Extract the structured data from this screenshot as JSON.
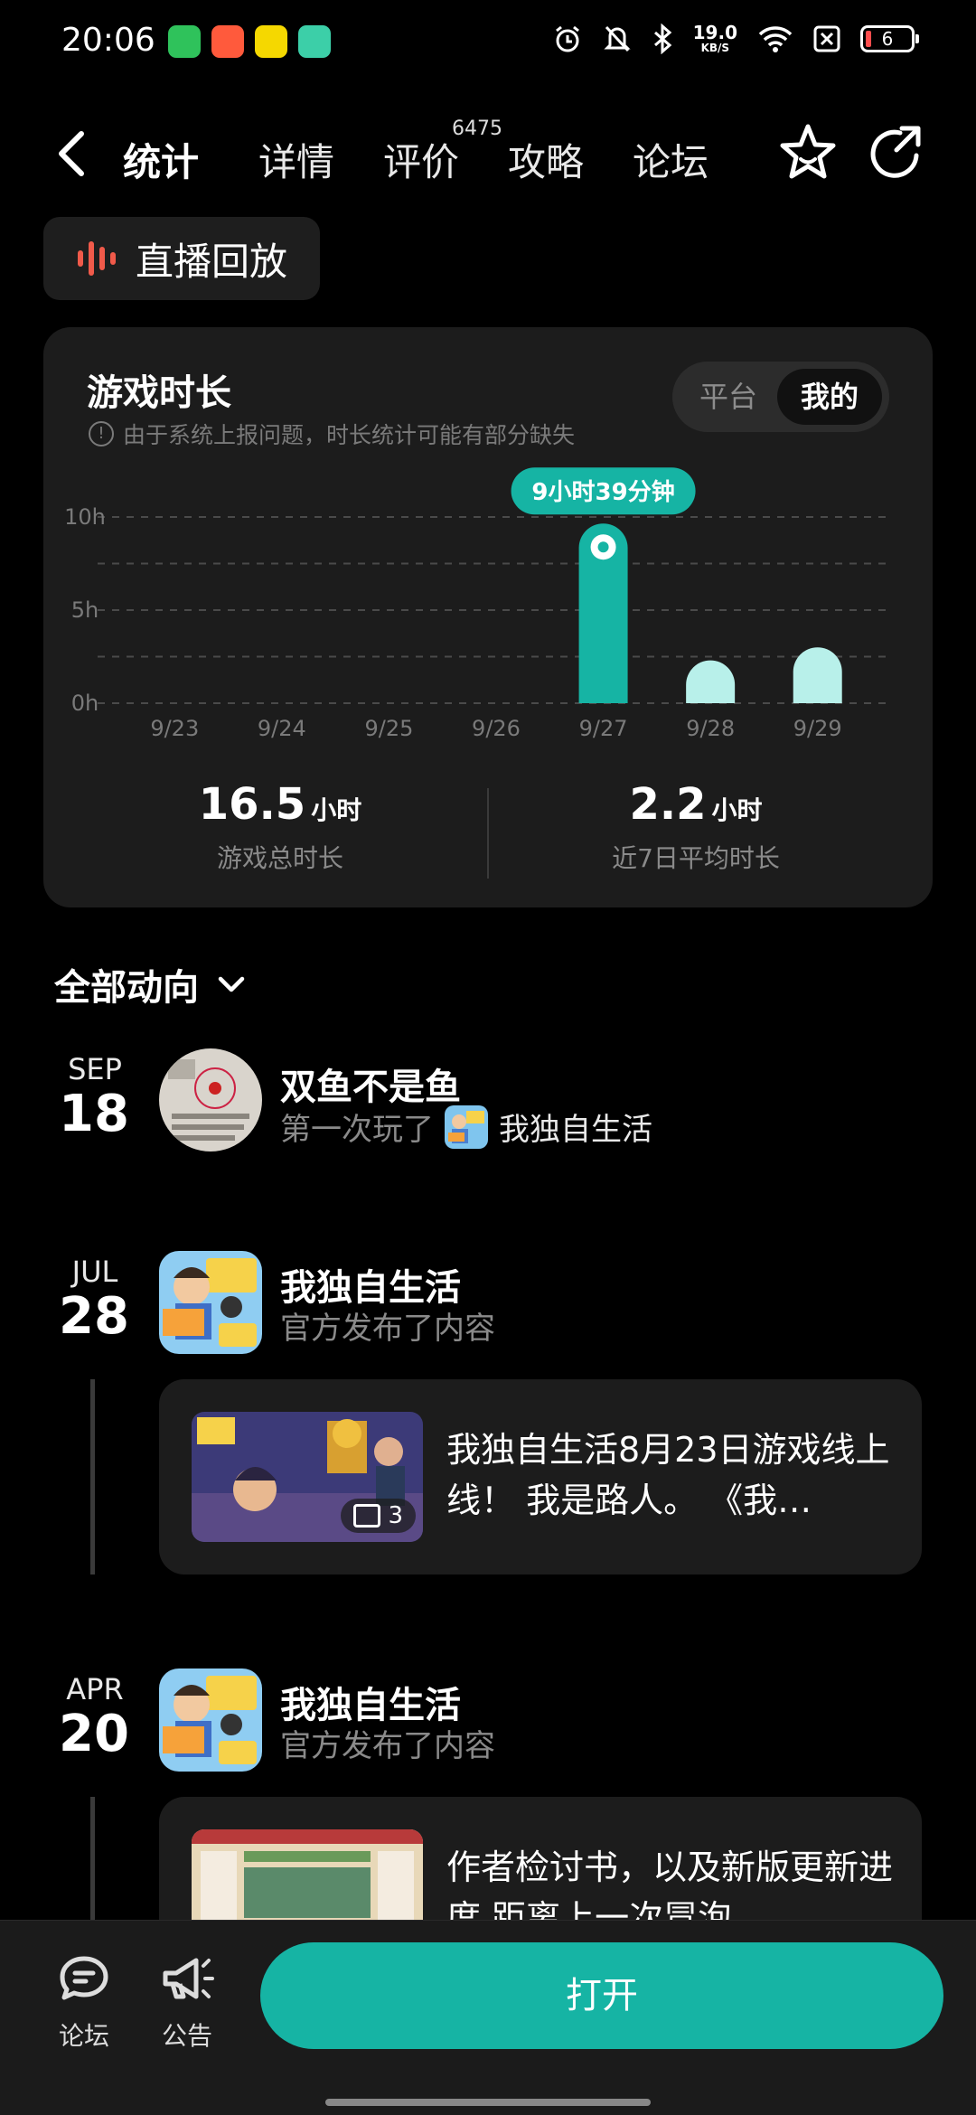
{
  "status_bar": {
    "time": "20:06",
    "net_speed_value": "19.0",
    "net_speed_unit": "KB/S",
    "battery": "6"
  },
  "nav": {
    "tabs": [
      {
        "label": "统计",
        "active": true
      },
      {
        "label": "详情",
        "active": false
      },
      {
        "label": "评价",
        "active": false,
        "badge": "6475"
      },
      {
        "label": "攻略",
        "active": false
      },
      {
        "label": "论坛",
        "active": false
      }
    ],
    "icons": [
      "back-icon",
      "star-icon",
      "share-icon"
    ]
  },
  "live_replay": {
    "label": "直播回放"
  },
  "stats": {
    "title": "游戏时长",
    "note": "由于系统上报问题，时长统计可能有部分缺失",
    "toggle": {
      "options": [
        "平台",
        "我的"
      ],
      "selected": "我的"
    },
    "total_value": "16.5",
    "total_unit": "小时",
    "total_label": "游戏总时长",
    "avg_value": "2.2",
    "avg_unit": "小时",
    "avg_label": "近7日平均时长"
  },
  "chart_data": {
    "type": "bar",
    "categories": [
      "9/23",
      "9/24",
      "9/25",
      "9/26",
      "9/27",
      "9/28",
      "9/29"
    ],
    "values": [
      0,
      0,
      0,
      0,
      9.65,
      2.3,
      3.0
    ],
    "y_ticks": [
      "10h",
      "5h",
      "0h"
    ],
    "ylim": [
      0,
      10
    ],
    "highlight_index": 4,
    "highlight_label": "9小时39分钟",
    "grid": true,
    "colors": {
      "highlight": "#16b4a4",
      "normal": "#b8f0ea"
    }
  },
  "feed": {
    "header": "全部动向",
    "items": [
      {
        "month": "SEP",
        "day": "18",
        "name": "双鱼不是鱼",
        "action": "第一次玩了",
        "game": "我独自生活"
      },
      {
        "month": "JUL",
        "day": "28",
        "name": "我独自生活",
        "action": "官方发布了内容",
        "post_text": "我独自生活8月23日游戏线上线！ 我是路人。 《我…",
        "image_count": "3"
      },
      {
        "month": "APR",
        "day": "20",
        "name": "我独自生活",
        "action": "官方发布了内容",
        "post_text": "作者检讨书，以及新版更新进度 距离上一次冒泡"
      }
    ]
  },
  "bottom_bar": {
    "forum_label": "论坛",
    "notice_label": "公告",
    "open_label": "打开"
  },
  "colors": {
    "accent": "#16b4a4",
    "bg": "#000000",
    "card": "#1c1c1c"
  }
}
